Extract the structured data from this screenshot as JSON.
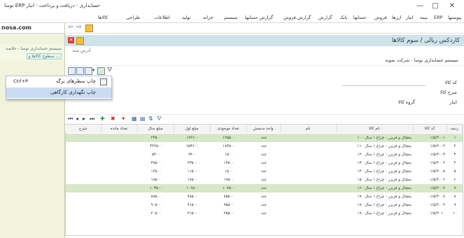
{
  "window": {
    "title": "نوسا ERP حسابداری - دریافت و پرداخت - انبار",
    "controls": [
      "—",
      "□",
      "✕"
    ]
  },
  "menu": [
    "پیوستها",
    "ERP",
    "بیمه",
    "انبار",
    "ارزها",
    "فروش",
    "حسابها",
    "بانک",
    "گزارش",
    "گزارش فروش",
    "گزارش حسابها",
    "سیستم",
    "خزانه",
    "تولید",
    "اطلاعات",
    "طراحی",
    "کالاها"
  ],
  "left": {
    "brand": "nosa.com",
    "line1": "سیستم حسابداری نوسا - خلاصه",
    "line2": "سطوح کالاها و ..."
  },
  "doc": {
    "title": "کاردکس ریالی / سوم کالاها",
    "subtitle": "سیستم حسابداری نوسا - شرکت نمونه",
    "address_hint": "آدرس سند",
    "labels": {
      "code": "کد کالا",
      "desc": "شرح کالا",
      "unit": "انبار",
      "group": "گروه کالا"
    }
  },
  "popup": {
    "items": [
      {
        "label": "چاپ سطرهای برگه",
        "shortcut": "Ctrl+P"
      },
      {
        "label": "چاپ نگهداری کارگاهی",
        "shortcut": ""
      }
    ]
  },
  "grid": {
    "headers": [
      "ردیف",
      "کد کالا",
      "نام کالا",
      "نام",
      "واحد سنجش",
      "تعداد موجودی",
      "مبلغ اول",
      "مبلغ سال",
      "تعداد مانده",
      "شرح"
    ],
    "rows": [
      {
        "n": "۱",
        "code": "۰۱/۵/۲۰۰۱",
        "name": "بخچال و فریزر - چراغ ۱ سال ۱۰۰",
        "unit": "عدد",
        "a": "۲۴۵۰۰",
        "b": "۱۷۲۶۰۰",
        "c": "۱۲۵۵۰۰",
        "hl": true
      },
      {
        "n": "۲",
        "code": "۰۱/۵/۲۰۰۲",
        "name": "بخچال و فریزر - چراغ ۱ سال ۱۱۰",
        "unit": "عدد",
        "a": "۳۴۲۵۰۰",
        "b": "۶۵۳۶۰۰",
        "c": "۱۸۳۵۰۰",
        "hl": false
      },
      {
        "n": "۳",
        "code": "۰۱/۵/۲۰۰۳",
        "name": "بخچال و فریزر - چراغ ۱ سال ۱۲۰",
        "unit": "عدد",
        "a": "۵۴۰۰",
        "b": "۹۴۰۰",
        "c": "۱۵۰۰",
        "hl": false
      },
      {
        "n": "۴",
        "code": "۰۱/۵/۲۰۰۴",
        "name": "بخچال و فریزر - چراغ ۱ سال ۱۳۰",
        "unit": "عدد",
        "a": "۳۸۵۰۰",
        "b": "۲۳۵۰۰",
        "c": "۱۳۵۰۰",
        "hl": false
      },
      {
        "n": "۵",
        "code": "۰۱/۵/۲۰۰۵",
        "name": "بخچال و فریزر - چراغ ۱ سال ۱۴۰",
        "unit": "عدد",
        "a": "۱۲۵۰۰",
        "b": "۱۱۵۰۰",
        "c": "۱۵۰۰",
        "hl": false
      },
      {
        "n": "۶",
        "code": "۰۱/۵/۲۰۰۶",
        "name": "بخچال و فریزر - چراغ ۱ سال ۱۵۰",
        "unit": "عدد",
        "a": "۱۸۵۰۰",
        "b": "۱۷۵۰۰",
        "c": "۱۷۵۰۰",
        "hl": false
      },
      {
        "n": "۷",
        "code": "۰۱/۵/۲۰۰۷",
        "name": "بخچال و فریزر - چراغ ۱ سال ۱۶۰",
        "unit": "عدد",
        "a": "۱۰۳۵۰۰",
        "b": "۱۰۶۵۰۰",
        "c": "۱۰۷۵۰۰",
        "hl": true
      },
      {
        "n": "۸",
        "code": "۰۱/۵/۲۰۰۸",
        "name": "بخچال و فریزر - چراغ ۱ سال ۱۷۰",
        "unit": "عدد",
        "a": "۸۸۵۰۰",
        "b": "۷۸۵۰۰",
        "c": "۸۵۵۰۰",
        "hl": false
      },
      {
        "n": "۹",
        "code": "۰۱/۵/۲۰۰۹",
        "name": "بخچال و فریزر - چراغ ۱ سال ۱۸۰",
        "unit": "عدد",
        "a": "۹۰۵۰۰",
        "b": "۹۱۵۰۰",
        "c": "۹۵۵۰۰",
        "hl": false
      },
      {
        "n": "۱۰",
        "code": "۰۱/۵/۲۰۱۰",
        "name": "بخچال و فریزر - چراغ ۱ سال ۱۹۰",
        "unit": "عدد",
        "a": "۲۰۵۰۰",
        "b": "۲۱۵۰۰",
        "c": "۲۵۵۰۰",
        "hl": false
      }
    ]
  },
  "colors": {
    "docbar": "#cfe3ea",
    "leftpane": "#f1f3dd",
    "highlight_row": "#d6e8c8",
    "popup_selected": "#c9dcf2"
  }
}
